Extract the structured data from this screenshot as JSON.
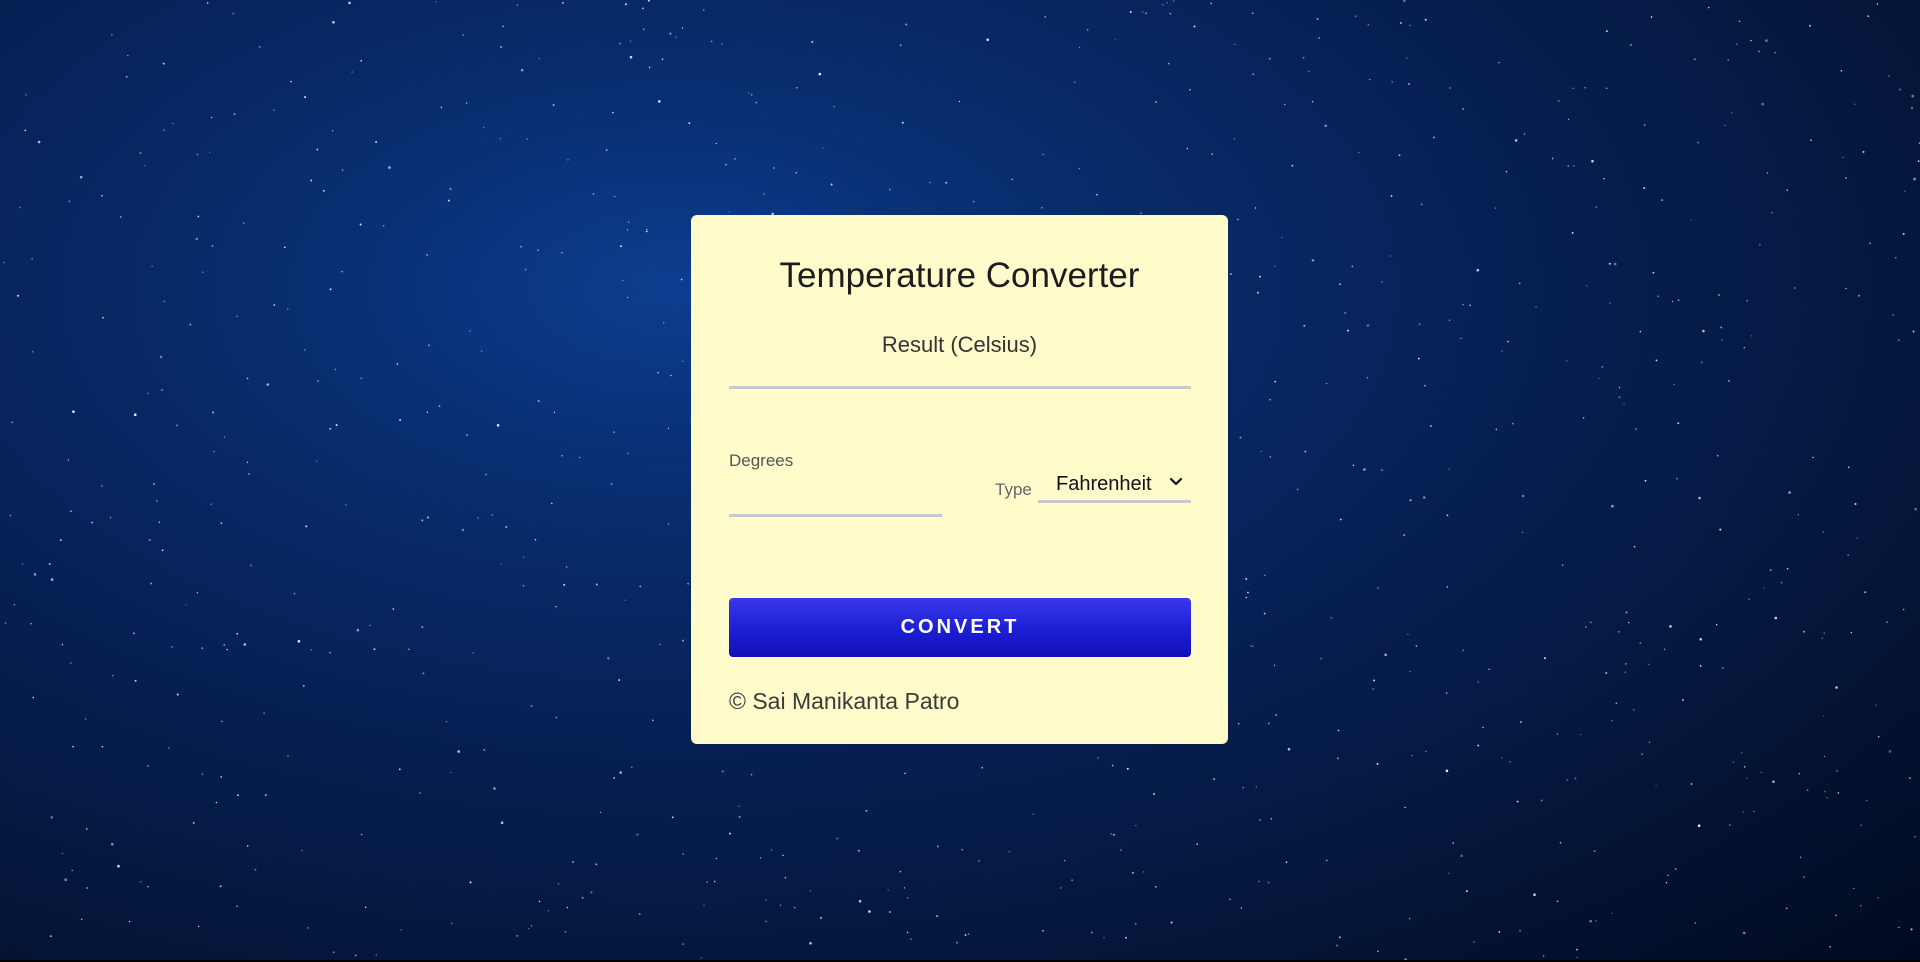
{
  "card": {
    "title": "Temperature Converter",
    "result_label": "Result (Celsius)",
    "result_value": "",
    "degrees_label": "Degrees",
    "degrees_value": "",
    "type_label": "Type",
    "type_selected": "Fahrenheit",
    "convert_label": "CONVERT",
    "footer": "© Sai Manikanta Patro"
  },
  "colors": {
    "card_background": "#fffbcb",
    "button_accent": "#2626dd",
    "underline": "#c6c9d2",
    "page_background": "#061f52"
  },
  "icons": {
    "select_arrow": "chevron-down-icon"
  }
}
